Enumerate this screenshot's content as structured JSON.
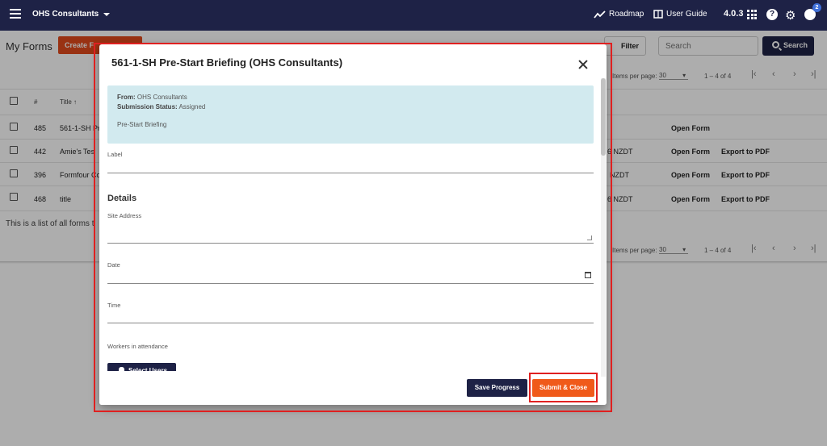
{
  "topbar": {
    "org_name": "OHS Consultants",
    "roadmap_label": "Roadmap",
    "user_guide_label": "User Guide",
    "version": "4.0.3",
    "notification_count": "2"
  },
  "page": {
    "title": "My Forms",
    "create_button": "Create F",
    "filter_label": "Filter",
    "search_placeholder": "Search",
    "search_button": "Search",
    "items_per_page_label": "Items per page:",
    "items_per_page_value": "30",
    "range_label": "1 – 4 of 4",
    "footnote": "This is a list of all forms t"
  },
  "table": {
    "headers": {
      "number": "#",
      "title": "Title ↑"
    },
    "rows": [
      {
        "id": "485",
        "title": "561-1-SH Pr",
        "date_frag": "",
        "open": "Open Form",
        "export": ""
      },
      {
        "id": "442",
        "title": "Amie's Tes",
        "date_frag": "6 NZDT",
        "open": "Open Form",
        "export": "Export to PDF"
      },
      {
        "id": "396",
        "title": "Formfour Co",
        "date_frag": "NZDT",
        "open": "Open Form",
        "export": "Export to PDF"
      },
      {
        "id": "468",
        "title": "title",
        "date_frag": "6 NZDT",
        "open": "Open Form",
        "export": "Export to PDF"
      }
    ]
  },
  "modal": {
    "title": "561-1-SH Pre-Start Briefing (OHS Consultants)",
    "info": {
      "from_label": "From:",
      "from_value": "OHS Consultants",
      "status_label": "Submission Status:",
      "status_value": "Assigned",
      "description": "Pre-Start Briefing"
    },
    "label_field": "Label",
    "section_title": "Details",
    "site_address_label": "Site Address",
    "date_label": "Date",
    "time_label": "Time",
    "workers_label": "Workers in attendance",
    "select_users_button": "Select Users",
    "save_progress_button": "Save Progress",
    "submit_close_button": "Submit & Close"
  },
  "colors": {
    "topbar": "#1e2246",
    "accent": "#f05a1a",
    "annotation": "#e02020"
  }
}
